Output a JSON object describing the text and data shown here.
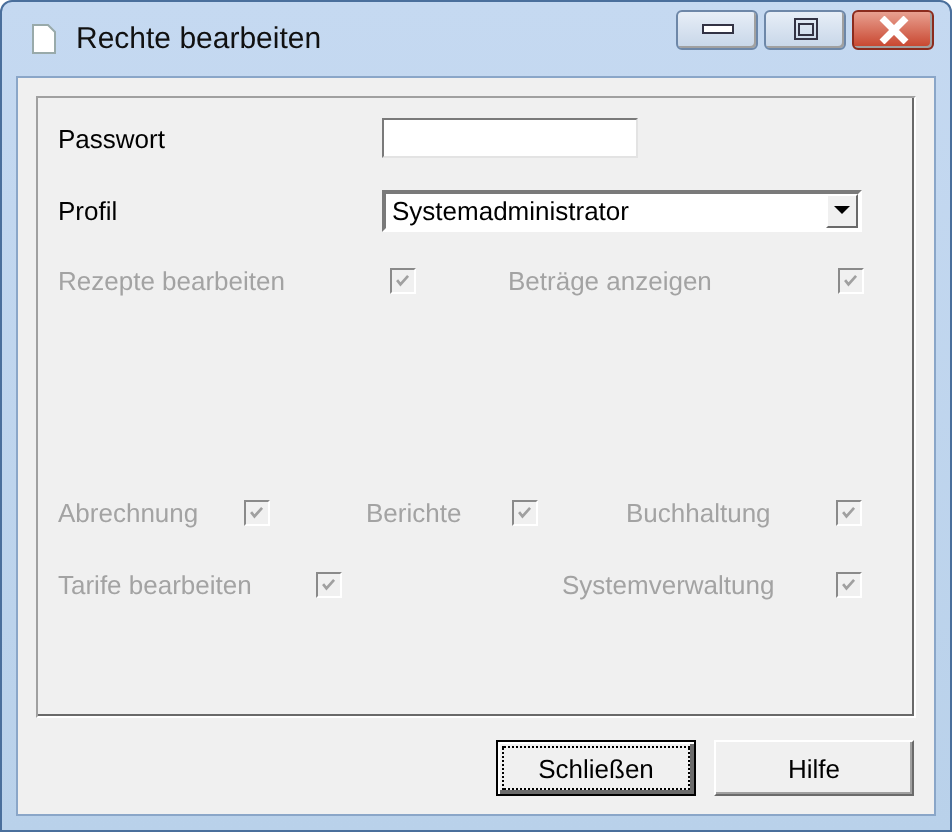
{
  "window": {
    "title": "Rechte bearbeiten"
  },
  "fields": [
    {
      "kind": "password",
      "label": "Passwort"
    },
    {
      "kind": "dropdown",
      "label": "Profil",
      "value": "Systemadministrator"
    }
  ],
  "permission_rows": [
    [
      {
        "label": "Rezepte bearbeiten",
        "checked": true,
        "disabled": true
      },
      {
        "label": "Beträge anzeigen",
        "checked": true,
        "disabled": true
      }
    ],
    [
      {
        "label": "Abrechnung",
        "checked": true,
        "disabled": true
      },
      {
        "label": "Berichte",
        "checked": true,
        "disabled": true
      },
      {
        "label": "Buchhaltung",
        "checked": true,
        "disabled": true
      }
    ],
    [
      {
        "label": "Tarife bearbeiten",
        "checked": true,
        "disabled": true
      },
      {
        "label": "Systemverwaltung",
        "checked": true,
        "disabled": true
      }
    ]
  ],
  "buttons": [
    {
      "label": "Schließen",
      "focused": true
    },
    {
      "label": "Hilfe",
      "focused": false
    }
  ]
}
